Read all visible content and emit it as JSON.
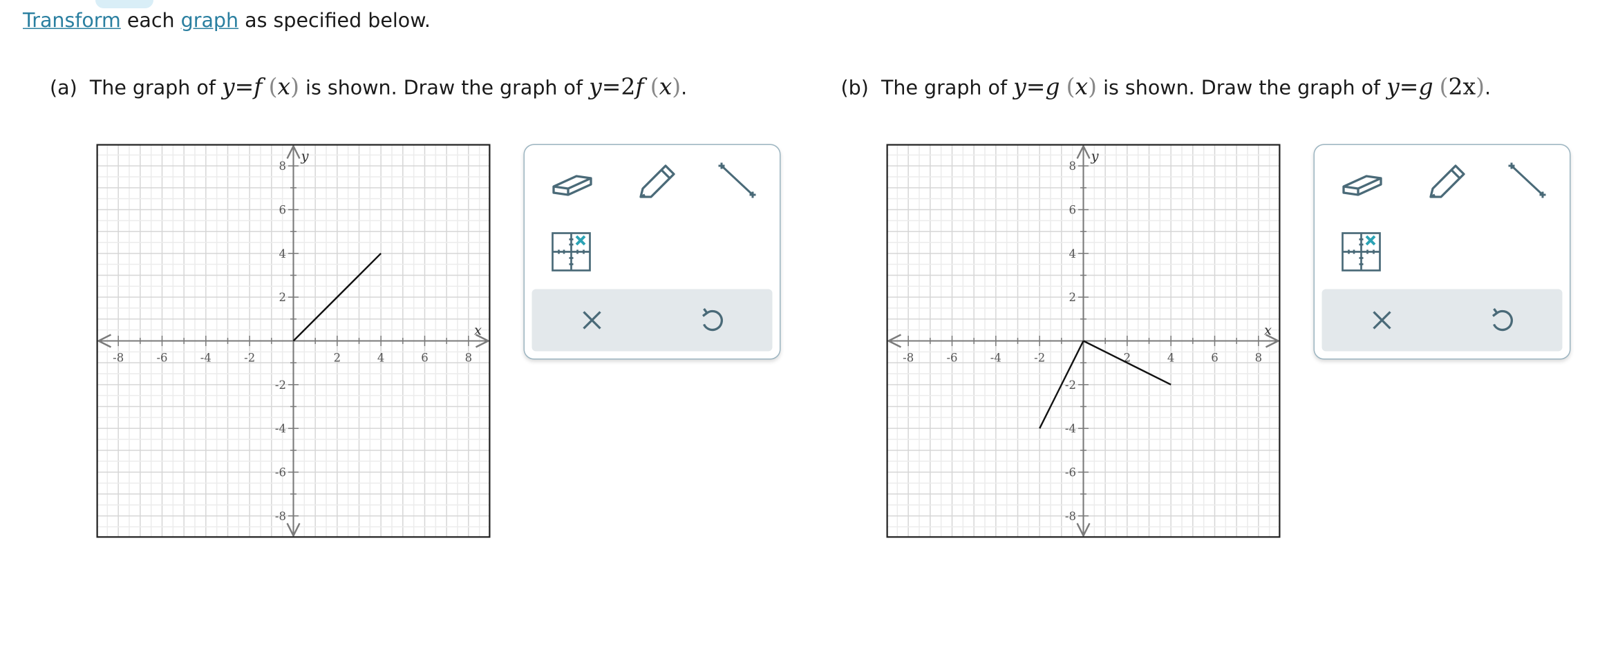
{
  "instruction": {
    "link1": "Transform",
    "middle": "each",
    "link2": "graph",
    "tail": "as specified below."
  },
  "part_a": {
    "label": "(a)",
    "text1": "The graph of",
    "given": {
      "y": "y",
      "eq": "=",
      "fn": "f",
      "arg": "x"
    },
    "text2": "is shown. Draw the graph of",
    "target": {
      "y": "y",
      "eq": "=",
      "coef": "2",
      "fn": "f",
      "arg": "x"
    },
    "end": "."
  },
  "part_b": {
    "label": "(b)",
    "text1": "The graph of",
    "given": {
      "y": "y",
      "eq": "=",
      "fn": "g",
      "arg": "x"
    },
    "text2": "is shown. Draw the graph of",
    "target": {
      "y": "y",
      "eq": "=",
      "fn": "g",
      "arg": "2x"
    },
    "end": "."
  },
  "graphs": [
    {
      "id": "graph-a",
      "x_label": "x",
      "y_label": "y",
      "xlim": [
        -9,
        9
      ],
      "ylim": [
        -9,
        9
      ],
      "x_tick_labels": [
        "-8",
        "-6",
        "-4",
        "-2",
        "2",
        "4",
        "6",
        "8"
      ],
      "y_tick_labels": [
        "8",
        "6",
        "4",
        "2",
        "-2",
        "-4",
        "-6",
        "-8"
      ],
      "segments": [
        [
          [
            0,
            0
          ],
          [
            4,
            4
          ]
        ]
      ]
    },
    {
      "id": "graph-b",
      "x_label": "x",
      "y_label": "y",
      "xlim": [
        -9,
        9
      ],
      "ylim": [
        -9,
        9
      ],
      "x_tick_labels": [
        "-8",
        "-6",
        "-4",
        "-2",
        "2",
        "4",
        "6",
        "8"
      ],
      "y_tick_labels": [
        "8",
        "6",
        "4",
        "2",
        "-2",
        "-4",
        "-6",
        "-8"
      ],
      "segments": [
        [
          [
            -2,
            -4
          ],
          [
            0,
            0
          ]
        ],
        [
          [
            0,
            0
          ],
          [
            4,
            -2
          ]
        ]
      ]
    }
  ],
  "tools": [
    "eraser-icon",
    "pencil-icon",
    "line-segment-icon",
    "point-grid-icon"
  ],
  "actions": [
    "clear-icon",
    "undo-icon"
  ],
  "colors": {
    "link": "#2a7fa0",
    "tool_stroke": "#4a6a78",
    "accent": "#2ba3b5",
    "action_bg": "#e3e8eb"
  }
}
